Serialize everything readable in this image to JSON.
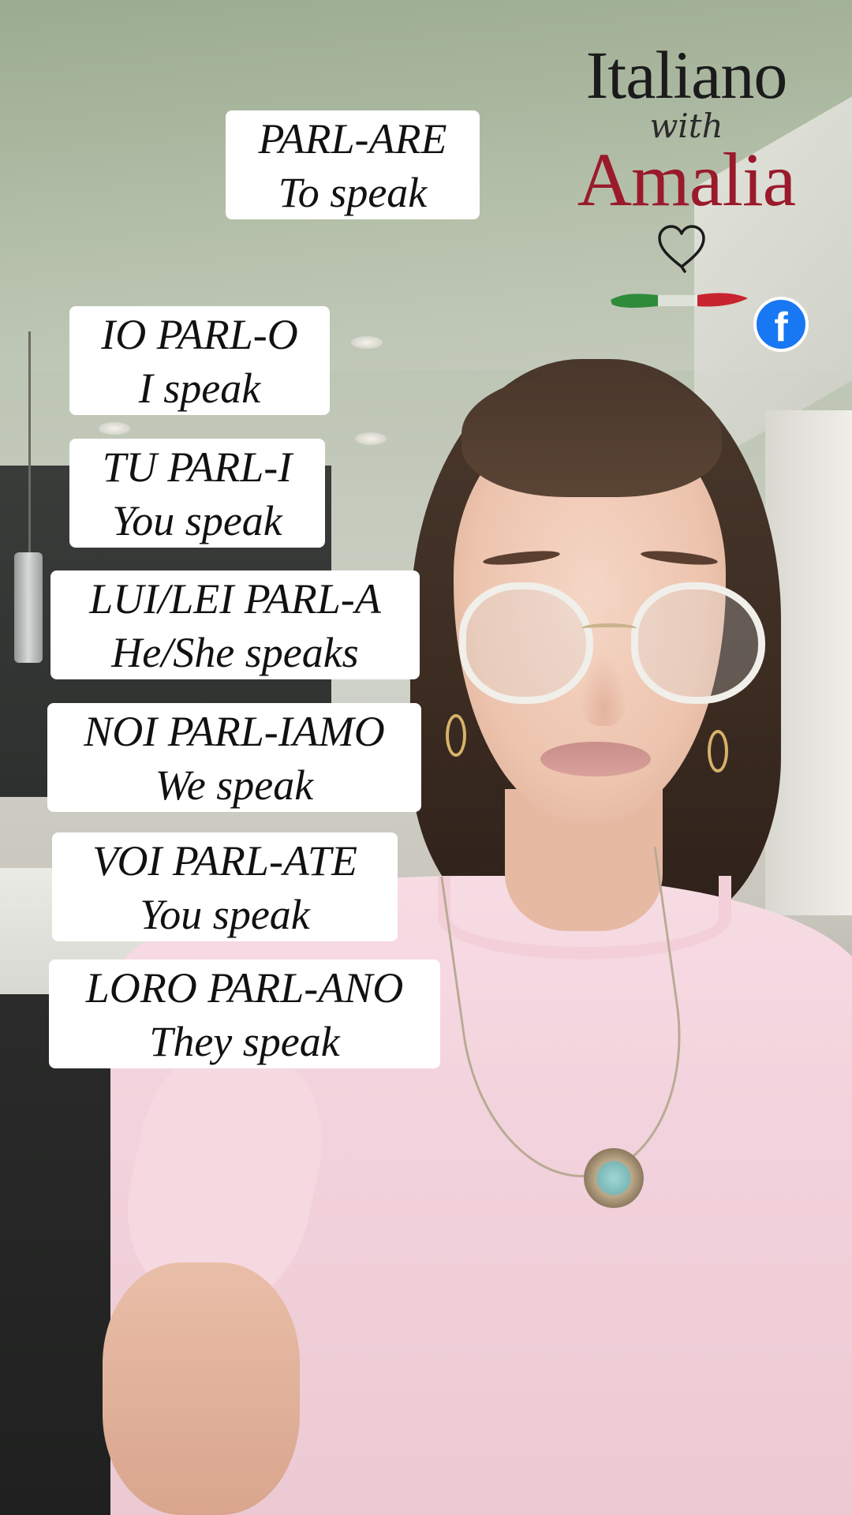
{
  "brand": {
    "title": "Italiano",
    "with": "with",
    "name": "Amalia",
    "heart_icon": "heart-outline-icon",
    "flag_icon": "italian-flag-brushstroke",
    "social_icon": "facebook-icon",
    "colors": {
      "title": "#1b1b1b",
      "name": "#9a1a2c",
      "facebook": "#1877f2"
    }
  },
  "cards": [
    {
      "line1": "PARL-ARE",
      "line2": "To speak"
    },
    {
      "line1": "IO PARL-O",
      "line2": "I speak"
    },
    {
      "line1": "TU PARL-I",
      "line2": "You speak"
    },
    {
      "line1": "LUI/LEI PARL-A",
      "line2": "He/She speaks"
    },
    {
      "line1": "NOI PARL-IAMO",
      "line2": "We speak"
    },
    {
      "line1": "VOI PARL-ATE",
      "line2": "You speak"
    },
    {
      "line1": "LORO PARL-ANO",
      "line2": "They speak"
    }
  ]
}
